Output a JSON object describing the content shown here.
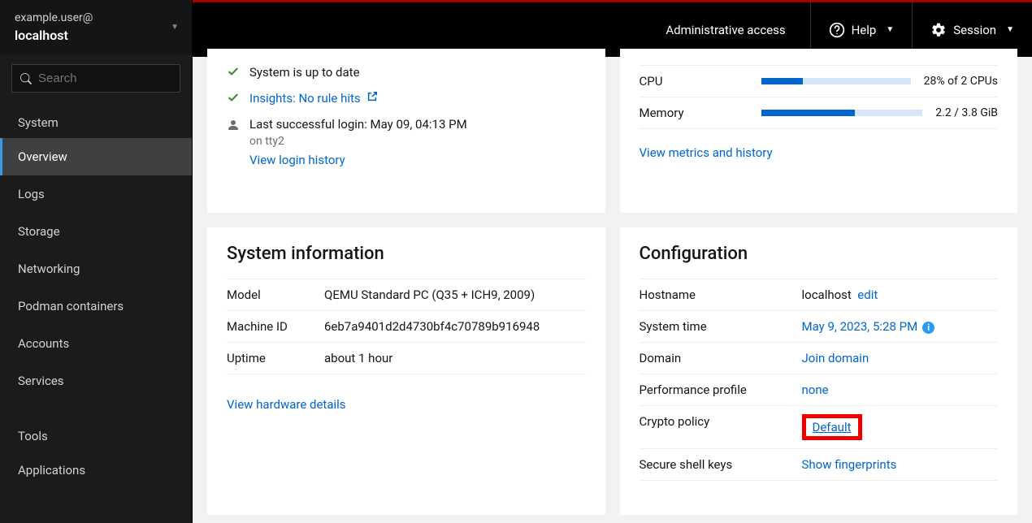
{
  "sidebar": {
    "user": "example.user@",
    "host": "localhost",
    "search_placeholder": "Search",
    "section_system": "System",
    "section_tools": "Tools",
    "items": [
      {
        "label": "Overview",
        "active": true
      },
      {
        "label": "Logs"
      },
      {
        "label": "Storage"
      },
      {
        "label": "Networking"
      },
      {
        "label": "Podman containers"
      },
      {
        "label": "Accounts"
      },
      {
        "label": "Services"
      }
    ],
    "tools": [
      {
        "label": "Applications"
      }
    ]
  },
  "topbar": {
    "admin": "Administrative access",
    "help": "Help",
    "session": "Session"
  },
  "health": {
    "up_to_date": "System is up to date",
    "insights": "Insights: No rule hits",
    "last_login_prefix": "Last successful login: ",
    "last_login_time": "May 09, 04:13 PM",
    "last_login_tty": "on tty2",
    "view_login": "View login history"
  },
  "usage": {
    "view_metrics": "View metrics and history",
    "cpu": {
      "label": "CPU",
      "value": "28% of 2 CPUs",
      "pct": 28
    },
    "mem": {
      "label": "Memory",
      "value": "2.2 / 3.8 GiB",
      "pct": 58
    }
  },
  "sysinfo": {
    "title": "System information",
    "rows": {
      "model_k": "Model",
      "model_v": "QEMU Standard PC (Q35 + ICH9, 2009)",
      "mid_k": "Machine ID",
      "mid_v": "6eb7a9401d2d4730bf4c70789b916948",
      "uptime_k": "Uptime",
      "uptime_v": "about 1 hour"
    },
    "hw_link": "View hardware details"
  },
  "config": {
    "title": "Configuration",
    "rows": {
      "hostname_k": "Hostname",
      "hostname_v": "localhost",
      "hostname_edit": "edit",
      "time_k": "System time",
      "time_v": "May 9, 2023, 5:28 PM",
      "domain_k": "Domain",
      "domain_v": "Join domain",
      "perf_k": "Performance profile",
      "perf_v": "none",
      "crypto_k": "Crypto policy",
      "crypto_v": "Default",
      "ssh_k": "Secure shell keys",
      "ssh_v": "Show fingerprints"
    }
  }
}
